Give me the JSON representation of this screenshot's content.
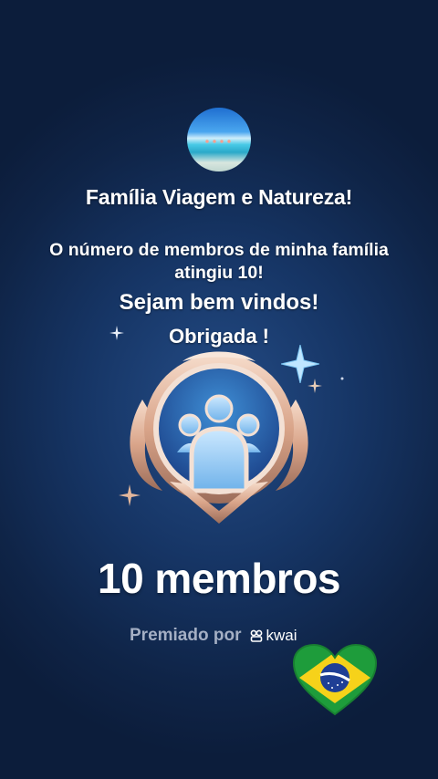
{
  "family": {
    "name": "Família Viagem e Natureza!",
    "message": "O número de membros de minha família atingiu 10!",
    "welcome": "Sejam bem vindos!",
    "thanks": "Obrigada !"
  },
  "milestone": {
    "count_text": "10 membros",
    "awarded_by_label": "Premiado por",
    "brand": "kwai"
  },
  "colors": {
    "background": "#163565",
    "badge_gold": "#d9a489",
    "badge_blue": "#3f8fd6",
    "text_muted": "#a4afc4"
  },
  "icons": [
    "family-avatar",
    "members-badge-icon",
    "sparkle-icon",
    "kwai-logo-icon",
    "brazil-flag-heart-icon"
  ]
}
